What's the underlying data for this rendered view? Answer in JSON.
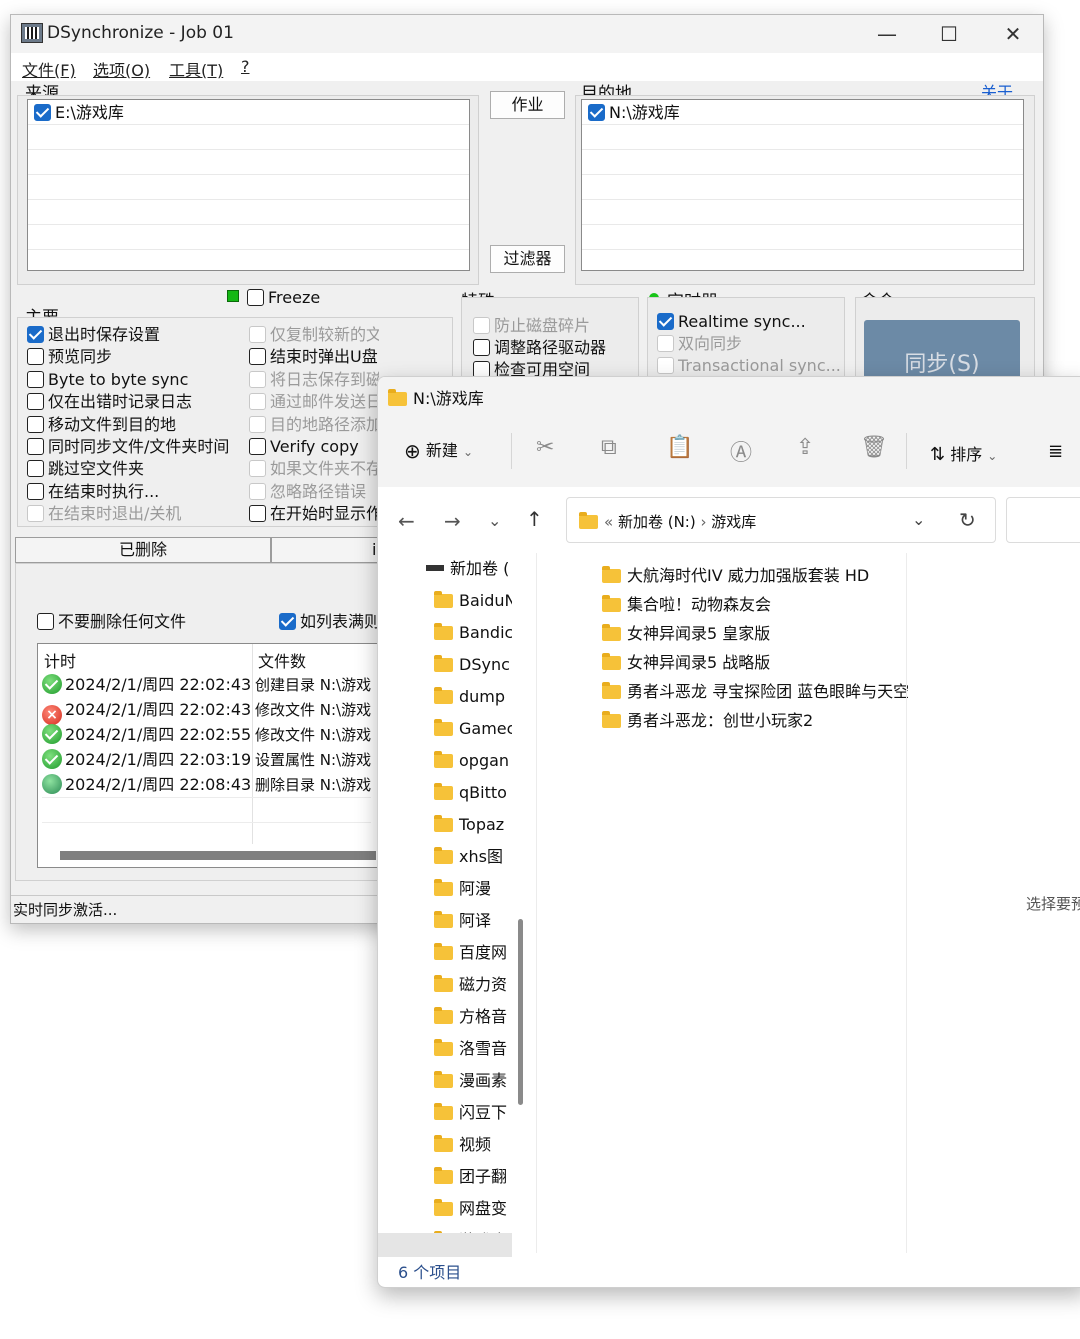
{
  "dsync": {
    "title": "DSynchronize - Job 01",
    "menu": [
      "文件(F)",
      "选项(O)",
      "工具(T)",
      "?"
    ],
    "source": {
      "label": "来源",
      "path": "E:\\游戏库",
      "checked": true
    },
    "dest": {
      "label": "目的地",
      "path": "N:\\游戏库",
      "checked": true
    },
    "about": "关于",
    "btn_job": "作业",
    "btn_filter": "过滤器",
    "freeze": "Freeze",
    "main_label": "主要",
    "main_options": [
      {
        "label": "退出时保存设置",
        "checked": true,
        "disabled": false
      },
      {
        "label": "预览同步",
        "checked": false,
        "disabled": false
      },
      {
        "label": "Byte to byte sync",
        "checked": false,
        "disabled": false
      },
      {
        "label": "仅在出错时记录日志",
        "checked": false,
        "disabled": false
      },
      {
        "label": "移动文件到目的地",
        "checked": false,
        "disabled": false
      },
      {
        "label": "同时同步文件/文件夹时间",
        "checked": false,
        "disabled": false
      },
      {
        "label": "跳过空文件夹",
        "checked": false,
        "disabled": false
      },
      {
        "label": "在结束时执行...",
        "checked": false,
        "disabled": false
      },
      {
        "label": "在结束时退出/关机",
        "checked": false,
        "disabled": true
      }
    ],
    "main_options2": [
      {
        "label": "仅复制较新的文件",
        "checked": false,
        "disabled": true
      },
      {
        "label": "结束时弹出U盘",
        "checked": false,
        "disabled": false
      },
      {
        "label": "将日志保存到磁盘",
        "checked": false,
        "disabled": true
      },
      {
        "label": "通过邮件发送日",
        "checked": false,
        "disabled": true
      },
      {
        "label": "目的地路径添加日期",
        "checked": false,
        "disabled": true
      },
      {
        "label": "Verify copy",
        "checked": false,
        "disabled": false
      },
      {
        "label": "如果文件夹不存在则",
        "checked": false,
        "disabled": true
      },
      {
        "label": "忽略路径错误",
        "checked": false,
        "disabled": true
      },
      {
        "label": "在开始时显示作",
        "checked": false,
        "disabled": false
      }
    ],
    "special_label": "特殊",
    "special_options": [
      {
        "label": "防止磁盘碎片",
        "checked": false,
        "disabled": true
      },
      {
        "label": "调整路径驱动器",
        "checked": false,
        "disabled": false
      },
      {
        "label": "检查可用空间",
        "checked": false,
        "disabled": false
      }
    ],
    "timer_label": "定时器",
    "timer_options": [
      {
        "label": "Realtime sync...",
        "checked": true,
        "disabled": false
      },
      {
        "label": "双向同步",
        "checked": false,
        "disabled": true
      },
      {
        "label": "Transactional sync...",
        "checked": false,
        "disabled": true
      }
    ],
    "command_label": "命令",
    "sync_button": "同步(S)",
    "tab_deleted": "已删除",
    "tab_other": "i",
    "no_delete": "不要删除任何文件",
    "if_list": "如列表满则",
    "log_headers": [
      "计时",
      "文件数"
    ],
    "log_rows": [
      {
        "status": "ok",
        "time": "2024/2/1/周四 22:02:43",
        "action": "创建目录 N:\\游戏"
      },
      {
        "status": "error",
        "time": "2024/2/1/周四 22:02:43",
        "action": "修改文件 N:\\游戏"
      },
      {
        "status": "ok",
        "time": "2024/2/1/周四 22:02:55",
        "action": "修改文件 N:\\游戏"
      },
      {
        "status": "ok",
        "time": "2024/2/1/周四 22:03:19",
        "action": "设置属性 N:\\游戏"
      },
      {
        "status": "deleted",
        "time": "2024/2/1/周四 22:08:43",
        "action": "删除目录 N:\\游戏"
      }
    ],
    "status": "实时同步激活..."
  },
  "explorer": {
    "title": "N:\\游戏库",
    "new_label": "新建",
    "sort_label": "排序",
    "breadcrumb": [
      "新加卷 (N:)",
      "游戏库"
    ],
    "nav_root": "新加卷 (",
    "nav_items": [
      "BaiduN",
      "Bandic",
      "DSync",
      "dump",
      "Gamec",
      "opgan",
      "qBitto",
      "Topaz",
      "xhs图",
      "阿漫",
      "阿译",
      "百度网",
      "磁力资",
      "方格音",
      "洛雪音",
      "漫画素",
      "闪豆下",
      "视频",
      "团子翻",
      "网盘变",
      "游戏库"
    ],
    "files": [
      "大航海时代IV 威力加强版套装 HD",
      "集合啦！动物森友会",
      "女神异闻录5 皇家版",
      "女神异闻录5 战略版",
      "勇者斗恶龙 寻宝探险团 蓝色眼眸与天空",
      "勇者斗恶龙：创世小玩家2"
    ],
    "preview_hint": "选择要预",
    "item_count": "6 个项目"
  },
  "colors": {
    "accent": "#1a6bc9",
    "sync_button": "#6c8aa6",
    "folder": "#f6c239"
  }
}
